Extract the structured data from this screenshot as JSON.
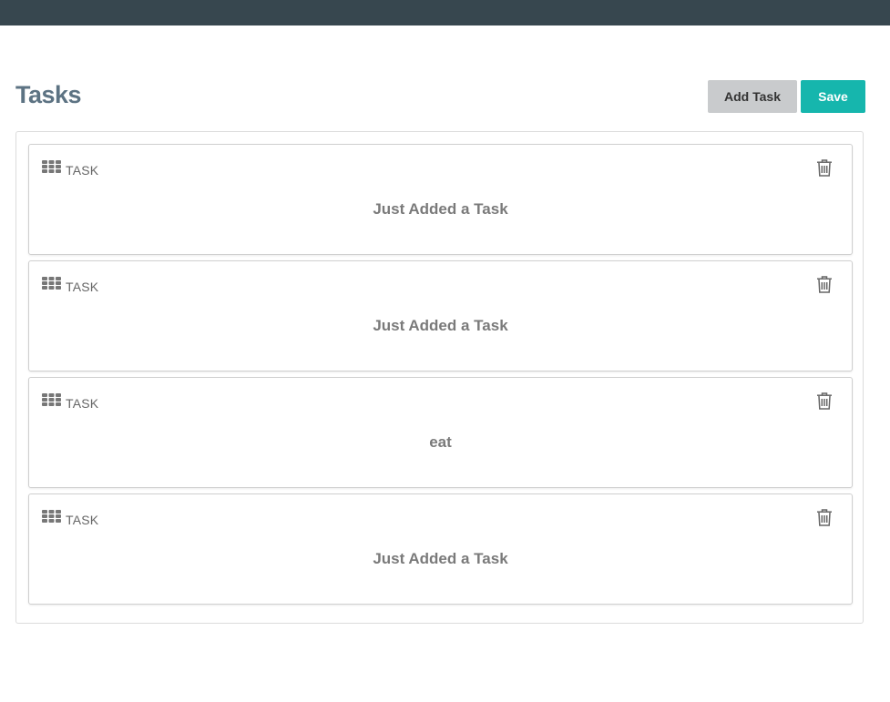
{
  "header": {
    "title": "Tasks",
    "add_task_label": "Add Task",
    "save_label": "Save"
  },
  "colors": {
    "topbar": "#37474f",
    "title": "#5d7383",
    "save_button": "#16b6ad",
    "add_button": "#c9cbcd"
  },
  "tasks": [
    {
      "label": "TASK",
      "text": "Just Added a Task",
      "drag_icon": "grip-icon",
      "delete_icon": "trash-icon"
    },
    {
      "label": "TASK",
      "text": "Just Added a Task",
      "drag_icon": "grip-icon",
      "delete_icon": "trash-icon"
    },
    {
      "label": "TASK",
      "text": "eat",
      "drag_icon": "grip-icon",
      "delete_icon": "trash-icon"
    },
    {
      "label": "TASK",
      "text": "Just Added a Task",
      "drag_icon": "grip-icon",
      "delete_icon": "trash-icon"
    }
  ]
}
